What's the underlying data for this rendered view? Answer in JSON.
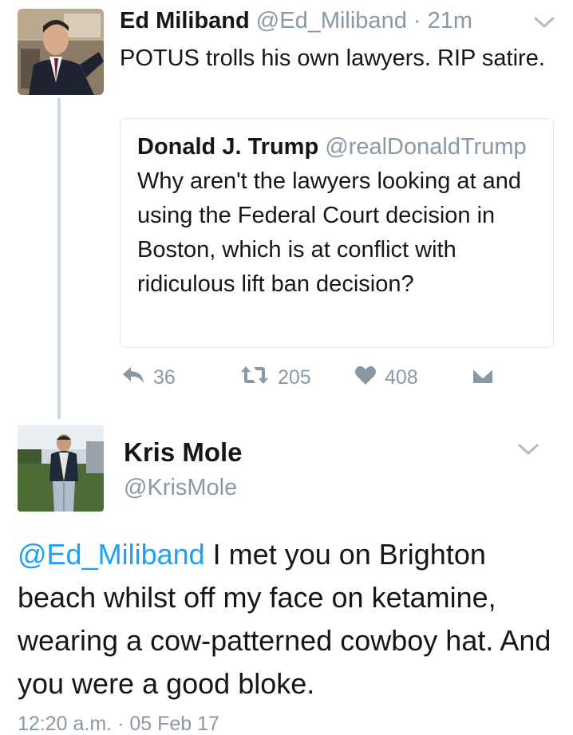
{
  "tweet1": {
    "name": "Ed Miliband",
    "handle": "@Ed_Miliband",
    "separator": " · ",
    "time": "21m",
    "text": "POTUS trolls his own lawyers. RIP satire.",
    "quote": {
      "name": "Donald J. Trump",
      "handle": "@realDonaldTrump",
      "text": "Why aren't the lawyers looking at and using the Federal Court decision in Boston, which is at conflict with ridiculous lift ban decision?"
    },
    "actions": {
      "reply_count": "36",
      "retweet_count": "205",
      "like_count": "408"
    }
  },
  "tweet2": {
    "name": "Kris Mole",
    "handle": "@KrisMole",
    "mention": "@Ed_Miliband",
    "text": " I met you on Brighton beach whilst off my face on ketamine, wearing a cow-patterned cowboy hat. And you were a good bloke.",
    "timestamp": "12:20 a.m. · 05 Feb 17"
  },
  "colors": {
    "link": "#1da1f2",
    "muted": "#8899a6",
    "text": "#14171a",
    "thread_line": "#ccd6dd"
  },
  "icons": [
    "reply-icon",
    "retweet-icon",
    "like-icon",
    "direct-message-icon",
    "chevron-down-icon"
  ]
}
